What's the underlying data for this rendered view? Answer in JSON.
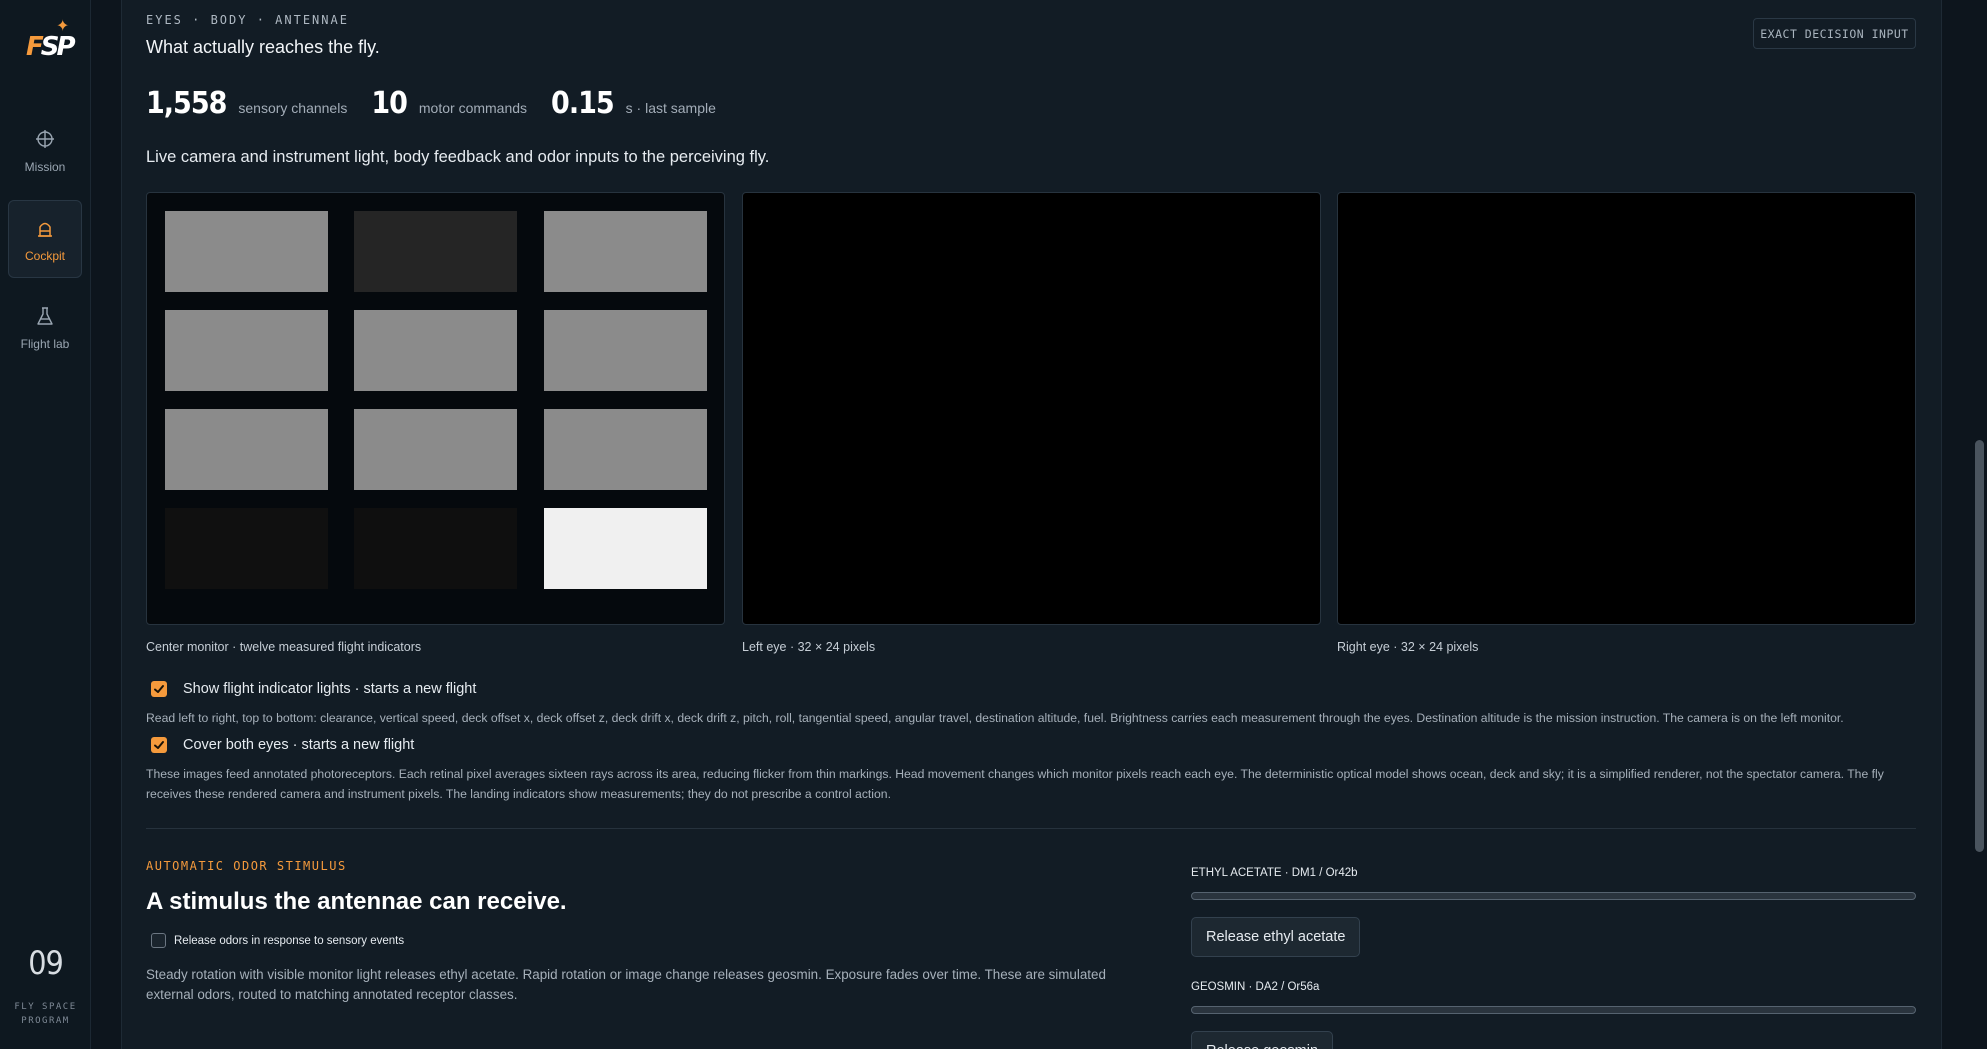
{
  "sidebar": {
    "items": [
      {
        "label": "Mission",
        "icon": "crosshair-icon",
        "active": false
      },
      {
        "label": "Cockpit",
        "icon": "cockpit-icon",
        "active": true
      },
      {
        "label": "Flight lab",
        "icon": "flask-icon",
        "active": false
      }
    ],
    "mission_number": "09",
    "program_name": "FLY SPACE\nPROGRAM"
  },
  "section": {
    "eyebrow": "EYES · BODY · ANTENNAE",
    "title": "What actually reaches the fly.",
    "badge": "EXACT DECISION INPUT",
    "intro": "Live camera and instrument light, body feedback and odor inputs to the perceiving fly."
  },
  "stats": [
    {
      "value": "1,558",
      "unit": "sensory channels"
    },
    {
      "value": "10",
      "unit": "motor commands"
    },
    {
      "value": "0.15",
      "unit": "s · last sample"
    }
  ],
  "center_monitor": {
    "caption": "Center monitor · twelve measured flight indicators",
    "indicator_colors": [
      "#8b8b8b",
      "#252525",
      "#8b8b8b",
      "#8b8b8b",
      "#8b8b8b",
      "#8b8b8b",
      "#8b8b8b",
      "#8b8b8b",
      "#8b8b8b",
      "#101010",
      "#0f0f0f",
      "#f0f0f0"
    ]
  },
  "left_eye": {
    "caption": "Left eye · 32 × 24 pixels"
  },
  "right_eye": {
    "caption": "Right eye · 32 × 24 pixels"
  },
  "options": {
    "show_lights_label": "Show flight indicator lights · starts a new flight",
    "show_lights_note": "Read left to right, top to bottom: clearance, vertical speed, deck offset x, deck offset z, deck drift x, deck drift z, pitch, roll, tangential speed, angular travel, destination altitude, fuel. Brightness carries each measurement through the eyes. Destination altitude is the mission instruction. The camera is on the left monitor.",
    "cover_eyes_label": "Cover both eyes · starts a new flight",
    "cover_eyes_note": "These images feed annotated photoreceptors. Each retinal pixel averages sixteen rays across its area, reducing flicker from thin markings. Head movement changes which monitor pixels reach each eye. The deterministic optical model shows ocean, deck and sky; it is a simplified renderer, not the spectator camera. The fly receives these rendered camera and instrument pixels. The landing indicators show measurements; they do not prescribe a control action."
  },
  "odor": {
    "eyebrow": "AUTOMATIC ODOR STIMULUS",
    "title": "A stimulus the antennae can receive.",
    "auto_label": "Release odors in response to sensory events",
    "description": "Steady rotation with visible monitor light releases ethyl acetate. Rapid rotation or image change releases geosmin. Exposure fades over time. These are simulated external odors, routed to matching annotated receptor classes.",
    "receptors": [
      {
        "label": "ETHYL ACETATE · DM1 / Or42b",
        "level": 0,
        "button": "Release ethyl acetate"
      },
      {
        "label": "GEOSMIN · DA2 / Or56a",
        "level": 0,
        "button": "Release geosmin"
      }
    ]
  },
  "colors": {
    "accent": "#f59a3c"
  }
}
